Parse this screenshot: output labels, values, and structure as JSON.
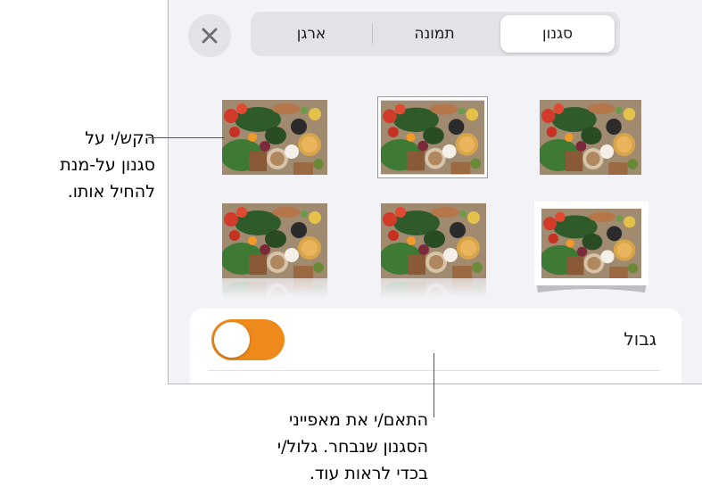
{
  "tabs": {
    "style": "סגנון",
    "image": "תמונה",
    "arrange": "ארגן"
  },
  "close_icon": "close-icon",
  "border_row": {
    "label": "גבול",
    "toggle_on": true
  },
  "callouts": {
    "left": [
      "הקש/י על",
      "סגנון על-מנת",
      "להחיל אותו."
    ],
    "bottom": [
      "התאם/י את מאפייני",
      "הסגנון שנבחר. גלול/י",
      "בכדי לראות עוד."
    ]
  },
  "colors": {
    "accent": "#ee8a1c",
    "panel": "#f2f2f7",
    "segment": "#e2e2e7"
  },
  "style_presets": [
    "style-thumb-plain",
    "style-thumb-border",
    "style-thumb-plain-2",
    "style-thumb-reflection",
    "style-thumb-reflection-2",
    "style-thumb-curl-shadow"
  ]
}
